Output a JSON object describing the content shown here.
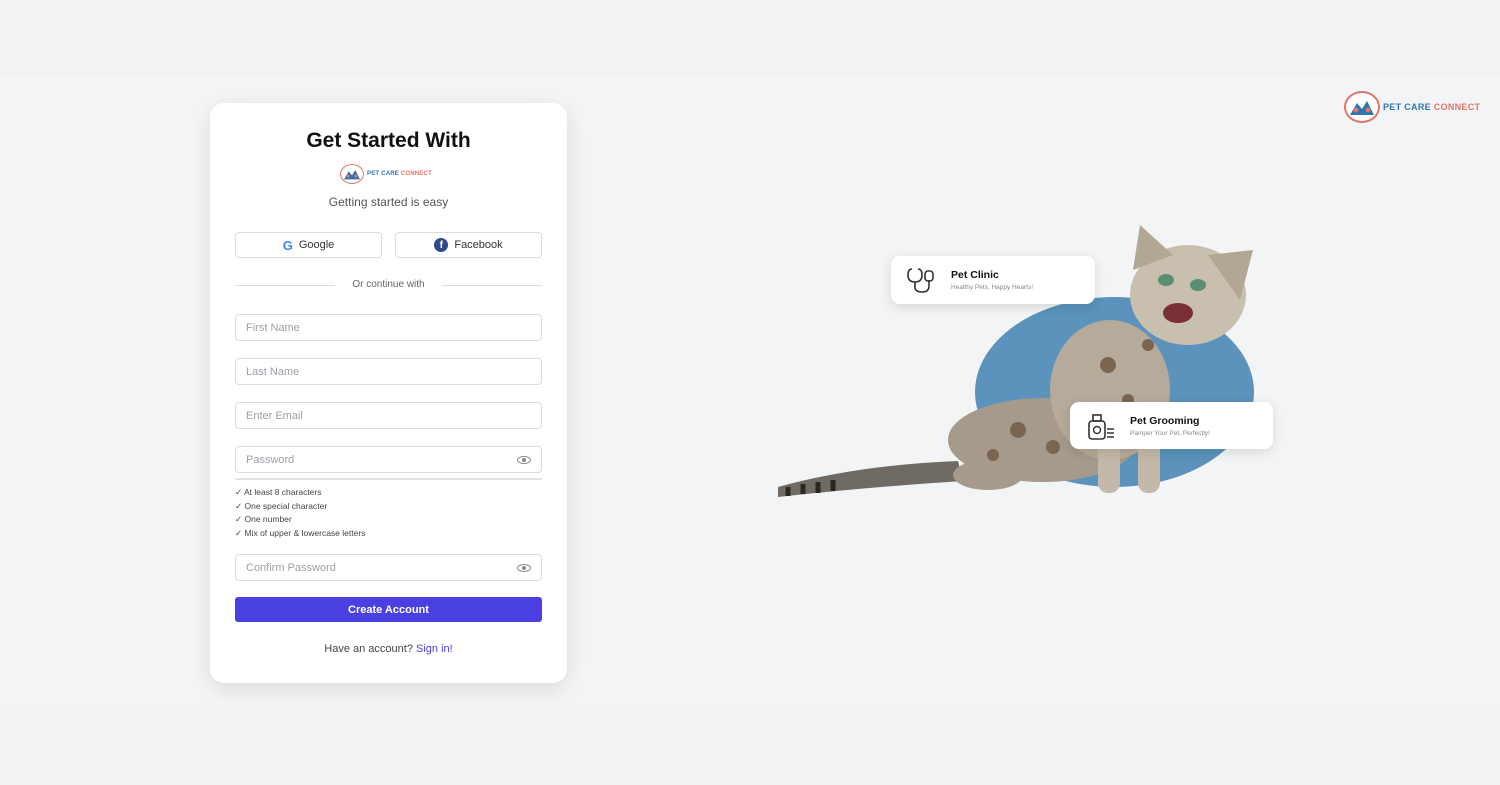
{
  "brand": {
    "word1": "PET",
    "word2": "CARE",
    "word3": "CONNECT",
    "colors": {
      "blue": "#2f73b3",
      "coral": "#e2756a",
      "accent": "#4a3fe0"
    }
  },
  "signup_card": {
    "title": "Get Started With",
    "subtitle": "Getting started is easy",
    "social": {
      "google_label": "Google",
      "google_icon": "google-icon",
      "facebook_label": "Facebook",
      "facebook_icon": "facebook-icon"
    },
    "divider_text": "Or continue with",
    "fields": {
      "first_name_placeholder": "First Name",
      "last_name_placeholder": "Last Name",
      "email_placeholder": "Enter Email",
      "password_placeholder": "Password",
      "confirm_password_placeholder": "Confirm Password"
    },
    "password_rules": [
      "✓ At least 8 characters",
      "✓ One special character",
      "✓ One number",
      "✓ Mix of upper & lowercase letters"
    ],
    "create_button_label": "Create Account",
    "signin_prompt": "Have an account?",
    "signin_link": "Sign in!"
  },
  "hero": {
    "clinic": {
      "title": "Pet Clinic",
      "subtitle": "Healthy Pets, Happy Hearts!",
      "icon": "stethoscope-icon"
    },
    "grooming": {
      "title": "Pet Grooming",
      "subtitle": "Pamper Your Pet, Perfectly!",
      "icon": "grooming-icon"
    }
  }
}
